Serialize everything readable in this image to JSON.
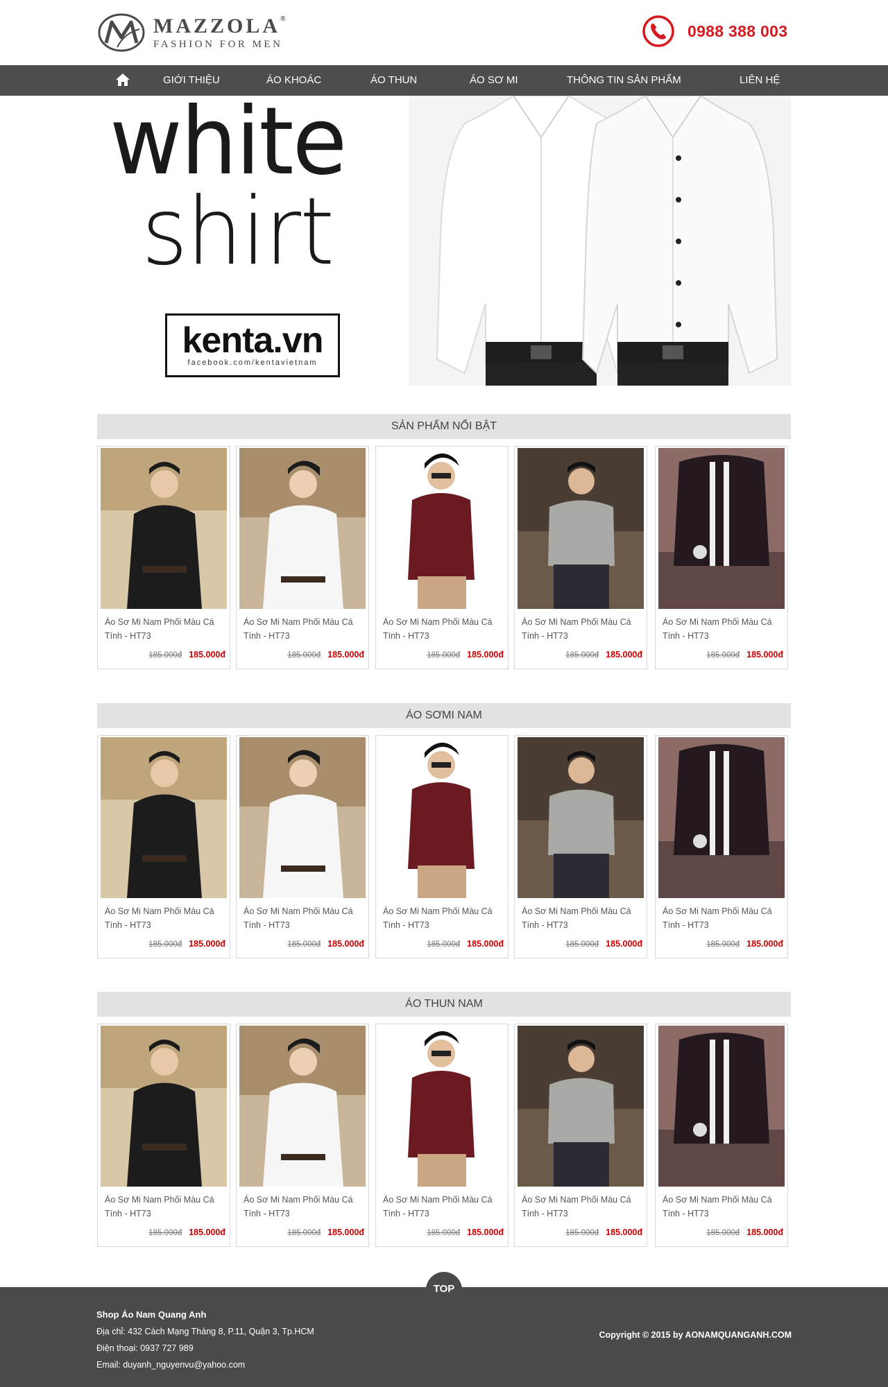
{
  "header": {
    "logo_name": "MAZZOLA",
    "logo_registered": "®",
    "logo_tagline": "FASHION FOR MEN",
    "phone_icon": "phone-icon",
    "hotline": "0988 388 003",
    "accent_color": "#d71920"
  },
  "nav": {
    "home_icon": "home-icon",
    "items": [
      {
        "label": "GIỚI THIỆU"
      },
      {
        "label": "ÁO KHOÁC"
      },
      {
        "label": "ÁO THUN"
      },
      {
        "label": "ÁO SƠ MI"
      },
      {
        "label": "THÔNG TIN SẢN PHẨM"
      },
      {
        "label": "LIÊN HỆ"
      }
    ]
  },
  "banner": {
    "title_line1": "white",
    "title_line2": "shirt",
    "brand": "kenta.vn",
    "brand_url": "facebook.com/kentavietnam"
  },
  "sections": [
    {
      "title": "SẢN PHẨM NỔI BẬT",
      "products": [
        {
          "name": "Áo Sơ Mi Nam Phối Màu Cá Tính - HT73",
          "old_price": "185.000đ",
          "price": "185.000đ"
        },
        {
          "name": "Áo Sơ Mi Nam Phối Màu Cá Tính - HT73",
          "old_price": "185.000đ",
          "price": "185.000đ"
        },
        {
          "name": "Áo Sơ Mi Nam Phối Màu Cá Tính - HT73",
          "old_price": "185.000đ",
          "price": "185.000đ"
        },
        {
          "name": "Áo Sơ Mi Nam Phối Màu Cá Tính - HT73",
          "old_price": "185.000đ",
          "price": "185.000đ"
        },
        {
          "name": "Áo Sơ Mi Nam Phối Màu Cá Tính - HT73",
          "old_price": "185.000đ",
          "price": "185.000đ"
        }
      ]
    },
    {
      "title": "ÁO SƠMI NAM",
      "products": [
        {
          "name": "Áo Sơ Mi Nam Phối Màu Cá Tính - HT73",
          "old_price": "185.000đ",
          "price": "185.000đ"
        },
        {
          "name": "Áo Sơ Mi Nam Phối Màu Cá Tính - HT73",
          "old_price": "185.000đ",
          "price": "185.000đ"
        },
        {
          "name": "Áo Sơ Mi Nam Phối Màu Cá Tính - HT73",
          "old_price": "185.000đ",
          "price": "185.000đ"
        },
        {
          "name": "Áo Sơ Mi Nam Phối Màu Cá Tính - HT73",
          "old_price": "185.000đ",
          "price": "185.000đ"
        },
        {
          "name": "Áo Sơ Mi Nam Phối Màu Cá Tính - HT73",
          "old_price": "185.000đ",
          "price": "185.000đ"
        }
      ]
    },
    {
      "title": "ÁO THUN NAM",
      "products": [
        {
          "name": "Áo Sơ Mi Nam Phối Màu Cá Tính - HT73",
          "old_price": "185.000đ",
          "price": "185.000đ"
        },
        {
          "name": "Áo Sơ Mi Nam Phối Màu Cá Tính - HT73",
          "old_price": "185.000đ",
          "price": "185.000đ"
        },
        {
          "name": "Áo Sơ Mi Nam Phối Màu Cá Tính - HT73",
          "old_price": "185.000đ",
          "price": "185.000đ"
        },
        {
          "name": "Áo Sơ Mi Nam Phối Màu Cá Tính - HT73",
          "old_price": "185.000đ",
          "price": "185.000đ"
        },
        {
          "name": "Áo Sơ Mi Nam Phối Màu Cá Tính - HT73",
          "old_price": "185.000đ",
          "price": "185.000đ"
        }
      ]
    }
  ],
  "footer": {
    "shop_name": "Shop Áo Nam Quang Anh",
    "address": "Địa chỉ: 432 Cách Mạng Tháng 8, P.11, Quận 3, Tp.HCM",
    "phone": "Điện thoại: 0937 727 989",
    "email": "Email: duyanh_nguyenvu@yahoo.com",
    "copyright": "Copyright © 2015 by AONAMQUANGANH.COM",
    "top_button": "TOP"
  }
}
